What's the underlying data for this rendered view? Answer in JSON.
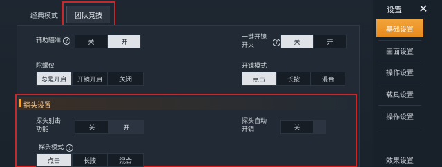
{
  "tabs": [
    {
      "label": "经典模式"
    },
    {
      "label": "团队竞技"
    }
  ],
  "settings": {
    "aim_assist": {
      "label": "辅助瞄准",
      "options": [
        "关",
        "开"
      ],
      "selected": "开"
    },
    "gyro": {
      "label": "陀螺仪",
      "options": [
        "总是开启",
        "开镜开启",
        "关闭"
      ],
      "selected": "总是开启"
    },
    "scope_fire": {
      "label": "一键开镜\n开火",
      "options": [
        "关",
        "开"
      ],
      "selected": "关"
    },
    "scope_mode": {
      "label": "开镜模式",
      "options": [
        "点击",
        "长按",
        "混合"
      ],
      "selected": "点击"
    }
  },
  "peek_section": {
    "title": "探头设置",
    "peek_shoot": {
      "label": "探头射击\n功能",
      "options": [
        "关",
        "开"
      ],
      "selected": "开"
    },
    "peek_auto_scope": {
      "label": "探头自动\n开镜",
      "options": [
        "关",
        ""
      ],
      "selected": "关"
    },
    "peek_mode": {
      "label": "探头模式",
      "options": [
        "点击",
        "长按",
        "混合"
      ],
      "selected": "点击"
    }
  },
  "sidebar": {
    "title": "设置",
    "close": "✕",
    "items": [
      {
        "label": "基础设置"
      },
      {
        "label": "画面设置"
      },
      {
        "label": "操作设置"
      },
      {
        "label": "载具设置"
      },
      {
        "label": "操作设置"
      },
      {
        "label": "效果设置"
      }
    ]
  },
  "colors": {
    "accent": "#e88a1c",
    "highlight": "#c8282a"
  }
}
